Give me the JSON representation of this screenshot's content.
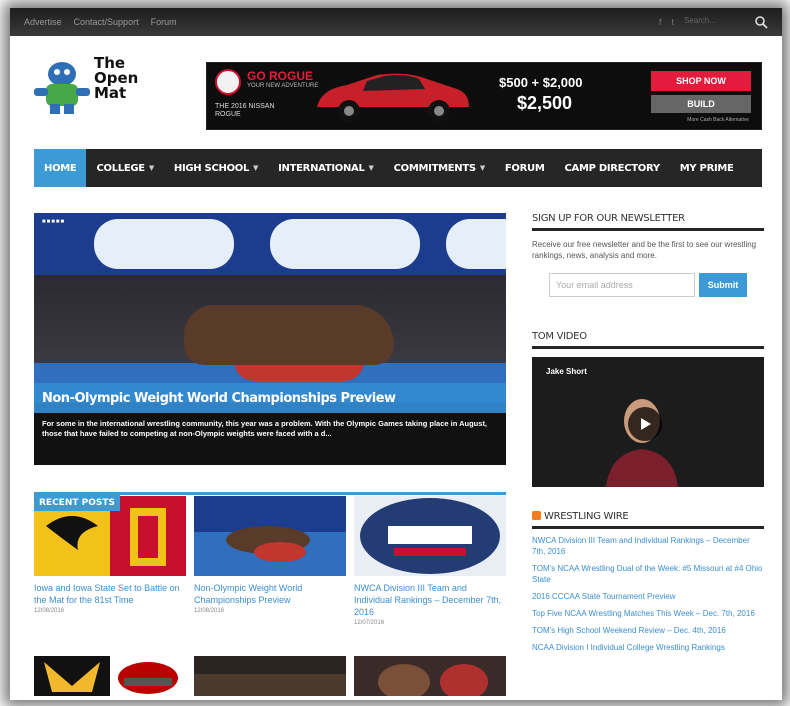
{
  "brand": {
    "logo_line1": "The",
    "logo_line2": "Open",
    "logo_line3": "Mat"
  },
  "topbar": {
    "links": [
      "Advertise",
      "Contact/Support",
      "Forum"
    ],
    "social": [
      "f",
      "t"
    ],
    "search_placeholder": "Search..."
  },
  "ad": {
    "headline": "GO ROGUE",
    "sub": "YOUR NEW ADVENTURE",
    "model": "THE 2016 NISSAN ROGUE",
    "offer1": "$500 + $2,000",
    "offer2": "$2,500",
    "shop_label": "SHOP NOW",
    "build_label": "BUILD",
    "fine": "More Cash Back Alternative"
  },
  "nav": {
    "items": [
      {
        "label": "HOME",
        "caret": false
      },
      {
        "label": "COLLEGE",
        "caret": true
      },
      {
        "label": "HIGH SCHOOL",
        "caret": true
      },
      {
        "label": "INTERNATIONAL",
        "caret": true
      },
      {
        "label": "COMMITMENTS",
        "caret": true
      },
      {
        "label": "FORUM",
        "caret": false
      },
      {
        "label": "CAMP DIRECTORY",
        "caret": false
      },
      {
        "label": "MY PRIME",
        "caret": false
      }
    ],
    "caret_glyph": "▼"
  },
  "hero": {
    "dots": "■■■■■",
    "title": "Non-Olympic Weight World Championships Preview",
    "excerpt": "For some in the international wrestling community, this year was a problem. With the Olympic Games taking place in August, those that have failed to competing at non-Olympic weights were faced with a d..."
  },
  "recent_posts": {
    "label": "RECENT POSTS",
    "cards": [
      {
        "title": "Iowa and Iowa State Set to Battle on the Mat for the 81st Time",
        "date": "12/08/2016"
      },
      {
        "title": "Non-Olympic Weight World Championships Preview",
        "date": "12/08/2016"
      },
      {
        "title": "NWCA Division III Team and Individual Rankings – December 7th, 2016",
        "date": "12/07/2016"
      }
    ]
  },
  "sidebar": {
    "newsletter_heading": "SIGN UP FOR OUR NEWSLETTER",
    "newsletter_text": "Receive our free newsletter and be the first to see our wrestling rankings, news, analysis and more.",
    "email_placeholder": "Your email address",
    "submit_label": "Submit",
    "video_heading": "TOM VIDEO",
    "video_title": "Jake Short",
    "wire_heading": "WRESTLING WIRE",
    "wire_items": [
      "NWCA Division III Team and Individual Rankings – December 7th, 2016",
      "TOM's NCAA Wrestling Dual of the Week: #5 Missouri at #4 Ohio State",
      "2016 CCCAA State Tournament Preview",
      "Top Five NCAA Wrestling Matches This Week – Dec. 7th, 2016",
      "TOM's High School Weekend Review – Dec. 4th, 2016",
      "NCAA Division I Individual College Wrestling Rankings"
    ]
  },
  "colors": {
    "accent": "#3c9ad4",
    "nav_bg": "#262626",
    "link": "#3c8ed1"
  }
}
